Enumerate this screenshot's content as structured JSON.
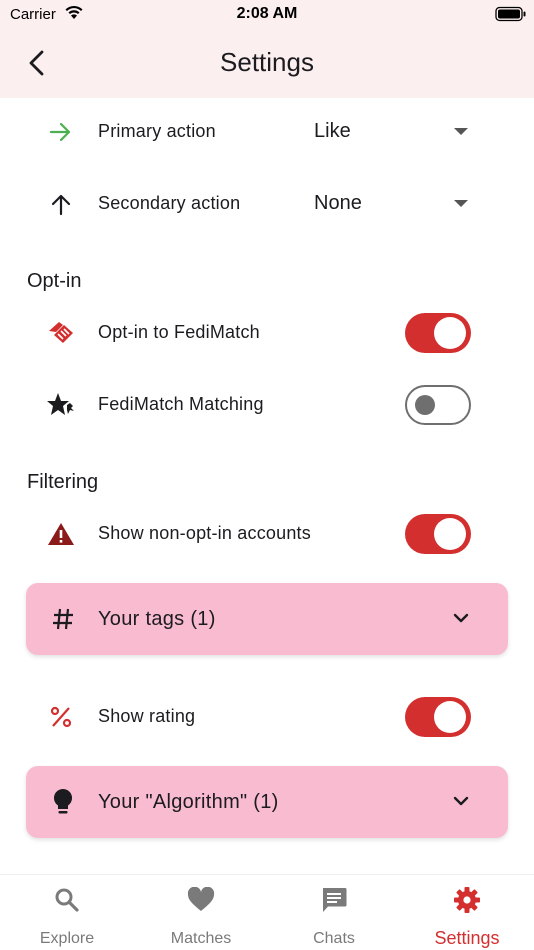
{
  "status_bar": {
    "carrier": "Carrier",
    "time": "2:08 AM"
  },
  "app_bar": {
    "title": "Settings"
  },
  "actions": {
    "primary": {
      "label": "Primary action",
      "value": "Like"
    },
    "secondary": {
      "label": "Secondary action",
      "value": "None"
    }
  },
  "opt_in": {
    "title": "Opt-in",
    "fedimatch_optin": {
      "label": "Opt-in to FediMatch",
      "on": true
    },
    "fedimatch_matching": {
      "label": "FediMatch Matching",
      "on": false
    }
  },
  "filtering": {
    "title": "Filtering",
    "show_non_optin": {
      "label": "Show non-opt-in accounts",
      "on": true
    },
    "tags_panel": {
      "label": "Your tags (1)"
    },
    "show_rating": {
      "label": "Show rating",
      "on": true
    },
    "algorithm_panel": {
      "label": "Your \"Algorithm\" (1)"
    }
  },
  "bottom_nav": {
    "items": [
      {
        "label": "Explore",
        "icon": "search-icon"
      },
      {
        "label": "Matches",
        "icon": "heart-icon"
      },
      {
        "label": "Chats",
        "icon": "chat-icon"
      },
      {
        "label": "Settings",
        "icon": "gear-icon",
        "active": true
      }
    ]
  },
  "colors": {
    "accent": "#d32f2f",
    "header_bg": "#fcefef",
    "panel_bg": "#f8bbd0",
    "primary_icon": "#4caf50"
  }
}
